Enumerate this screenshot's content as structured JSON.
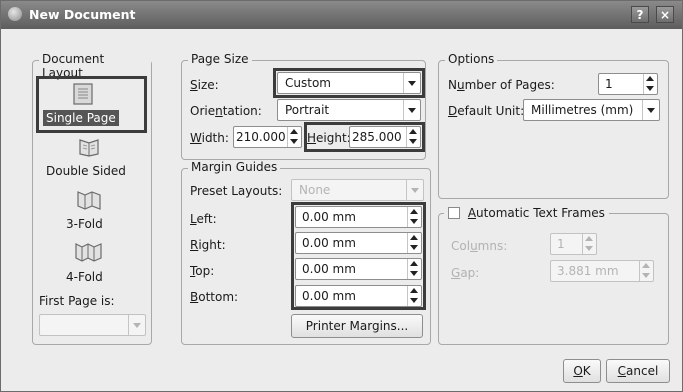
{
  "window": {
    "title": "New Document",
    "help_glyph": "?",
    "close_glyph": "×"
  },
  "document_layout": {
    "legend": "Document Layout",
    "items": [
      {
        "label": "Single Page",
        "icon": "single-page-icon",
        "selected": true
      },
      {
        "label": "Double Sided",
        "icon": "double-sided-icon",
        "selected": false
      },
      {
        "label": "3-Fold",
        "icon": "three-fold-icon",
        "selected": false
      },
      {
        "label": "4-Fold",
        "icon": "four-fold-icon",
        "selected": false
      }
    ],
    "first_page_label": "First Page is:",
    "first_page_value": ""
  },
  "page_size": {
    "legend": "Page Size",
    "size_label": "Size:",
    "size_value": "Custom",
    "orientation_label": "Orientation:",
    "orientation_value": "Portrait",
    "width_label": "Width:",
    "width_value": "210.000",
    "height_label": "Height:",
    "height_value": "285.000"
  },
  "margin_guides": {
    "legend": "Margin Guides",
    "preset_label": "Preset Layouts:",
    "preset_value": "None",
    "left_label": "Left:",
    "left_value": "0.00 mm",
    "right_label": "Right:",
    "right_value": "0.00 mm",
    "top_label": "Top:",
    "top_value": "0.00 mm",
    "bottom_label": "Bottom:",
    "bottom_value": "0.00 mm",
    "printer_margins_button": "Printer Margins..."
  },
  "options": {
    "legend": "Options",
    "pages_label": "Number of Pages:",
    "pages_value": "1",
    "unit_label": "Default Unit:",
    "unit_value": "Millimetres (mm)"
  },
  "auto_frames": {
    "legend": "Automatic Text Frames",
    "checked": false,
    "columns_label": "Columns:",
    "columns_value": "1",
    "gap_label": "Gap:",
    "gap_value": "3.881 mm"
  },
  "buttons": {
    "ok": "OK",
    "cancel": "Cancel"
  },
  "colors": {
    "highlight": "#3c3c3c",
    "titlebar": "#6e6e6e",
    "dialog_bg": "#ececec"
  }
}
